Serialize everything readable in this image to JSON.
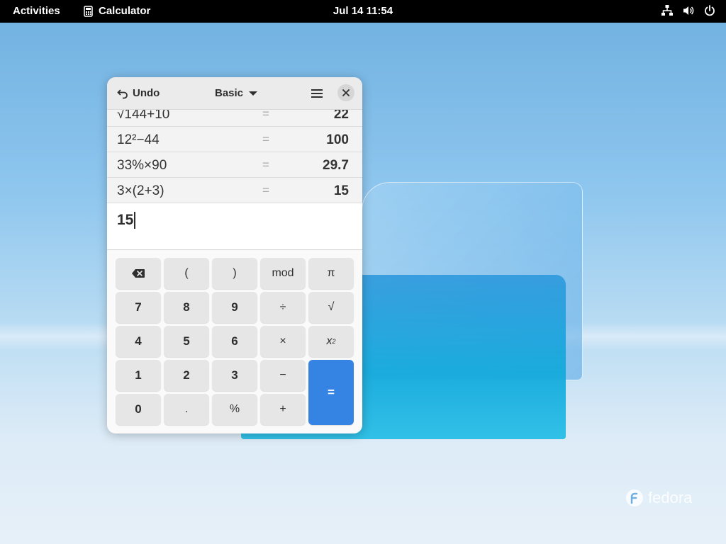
{
  "topbar": {
    "activities": "Activities",
    "app_name": "Calculator",
    "clock": "Jul 14  11:54",
    "status_icons": [
      "network-icon",
      "volume-icon",
      "power-icon"
    ]
  },
  "wallpaper": {
    "brand": "fedora"
  },
  "calculator": {
    "header": {
      "undo_label": "Undo",
      "mode_label": "Basic",
      "icons": [
        "undo-icon",
        "dropdown-arrow-icon",
        "hamburger-menu-icon",
        "close-icon"
      ]
    },
    "history": [
      {
        "expr": "√144+10",
        "eq": "=",
        "result": "22"
      },
      {
        "expr": "12²−44",
        "eq": "=",
        "result": "100"
      },
      {
        "expr": "33%×90",
        "eq": "=",
        "result": "29.7"
      },
      {
        "expr": "3×(2+3)",
        "eq": "=",
        "result": "15"
      }
    ],
    "entry_value": "15",
    "keys": {
      "open_paren": "(",
      "close_paren": ")",
      "mod": "mod",
      "pi": "π",
      "seven": "7",
      "eight": "8",
      "nine": "9",
      "divide": "÷",
      "sqrt": "√",
      "four": "4",
      "five": "5",
      "six": "6",
      "multiply": "×",
      "square_base": "x",
      "square_exp": "2",
      "one": "1",
      "two": "2",
      "three": "3",
      "minus": "−",
      "equals": "=",
      "zero": "0",
      "decimal": ".",
      "percent": "%",
      "plus": "+"
    },
    "accent_color": "#3584e4"
  }
}
